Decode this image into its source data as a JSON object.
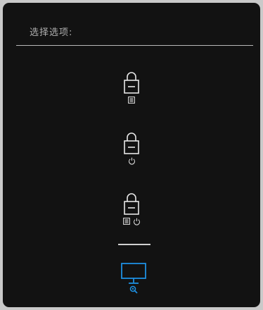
{
  "header": {
    "title": "选择选项:"
  },
  "options": [
    {
      "name": "lock-menu-buttons",
      "sub_icons": [
        "menu-icon"
      ]
    },
    {
      "name": "lock-power-button",
      "sub_icons": [
        "power-icon"
      ]
    },
    {
      "name": "lock-menu-and-power-buttons",
      "sub_icons": [
        "menu-icon",
        "power-icon"
      ]
    },
    {
      "name": "built-in-diagnostics",
      "icon": "monitor-diagnostics-icon",
      "selected": true
    }
  ],
  "colors": {
    "background": "#121212",
    "text": "#b0b0b0",
    "icon": "#e6e6e6",
    "selected_accent": "#1e8fe0"
  }
}
